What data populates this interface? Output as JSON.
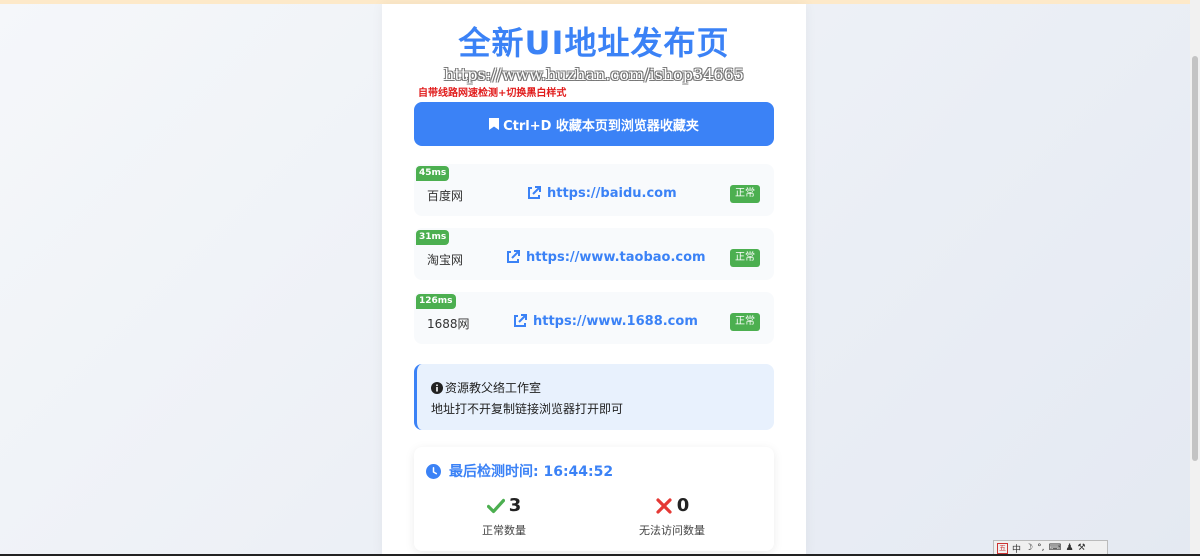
{
  "page": {
    "title": "全新UI地址发布页",
    "url_text": "https://www.huzhan.com/ishop34665",
    "subtitle": "自带线路网速检测+切换黑白样式",
    "bookmark_button": "Ctrl+D 收藏本页到浏览器收藏夹"
  },
  "sites": [
    {
      "latency": "45ms",
      "name": "百度网",
      "url": "https://baidu.com",
      "status": "正常"
    },
    {
      "latency": "31ms",
      "name": "淘宝网",
      "url": "https://www.taobao.com",
      "status": "正常"
    },
    {
      "latency": "126ms",
      "name": "1688网",
      "url": "https://www.1688.com",
      "status": "正常"
    }
  ],
  "info": {
    "title": "资源教父络工作室",
    "text": "地址打不开复制链接浏览器打开即可"
  },
  "stats": {
    "last_check": "最后检测时间: 16:44:52",
    "ok_count": "3",
    "ok_label": "正常数量",
    "fail_count": "0",
    "fail_label": "无法访问数量"
  },
  "ime": {
    "mode": "中",
    "punct": "°,"
  },
  "colors": {
    "accent": "#3b82f6",
    "ok": "#4caf50",
    "fail": "#e53935",
    "red_text": "#e11d1d"
  },
  "icons": [
    "bookmark-icon",
    "external-link-icon",
    "info-circle-icon",
    "clock-icon",
    "check-icon",
    "x-icon"
  ]
}
